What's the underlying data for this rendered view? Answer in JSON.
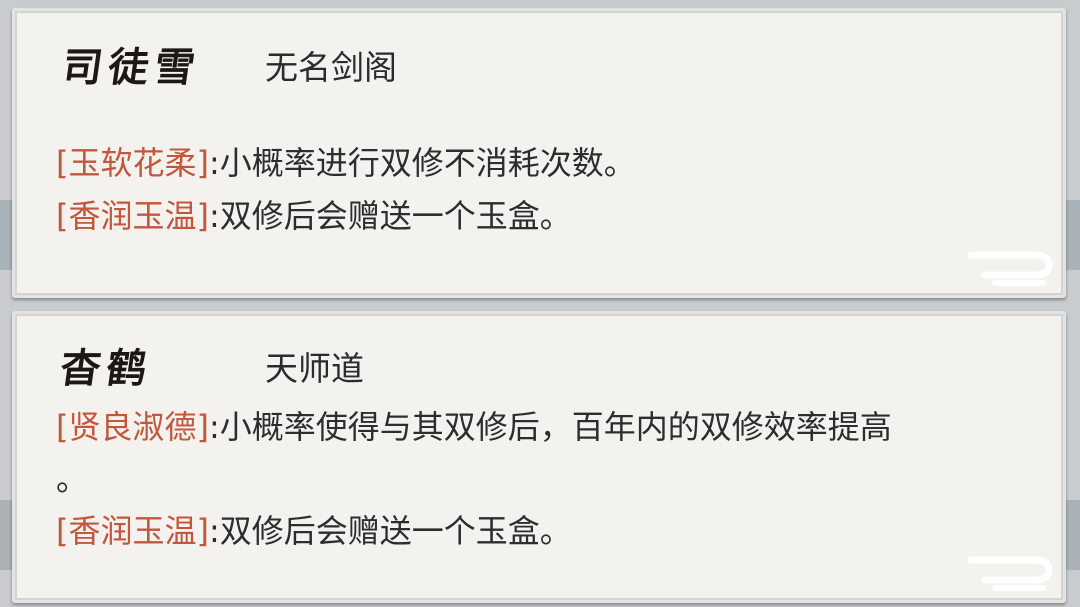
{
  "cards": [
    {
      "name": "司徒雪",
      "sect": "无名剑阁",
      "traits": [
        {
          "tag": "[玉软花柔]",
          "text": ":小概率进行双修不消耗次数。"
        },
        {
          "tag": "[香润玉温]",
          "text": ":双修后会赠送一个玉盒。"
        }
      ]
    },
    {
      "name": "杳鹤",
      "sect": "天师道",
      "traits": [
        {
          "tag": "[贤良淑德]",
          "text": ":小概率使得与其双修后，百年内的双修效率提高",
          "cont": "。"
        },
        {
          "tag": "[香润玉温]",
          "text": ":双修后会赠送一个玉盒。"
        }
      ]
    }
  ],
  "colors": {
    "tag": "#c4563c",
    "text": "#2f2d2b",
    "panel": "#f3f2ef"
  }
}
